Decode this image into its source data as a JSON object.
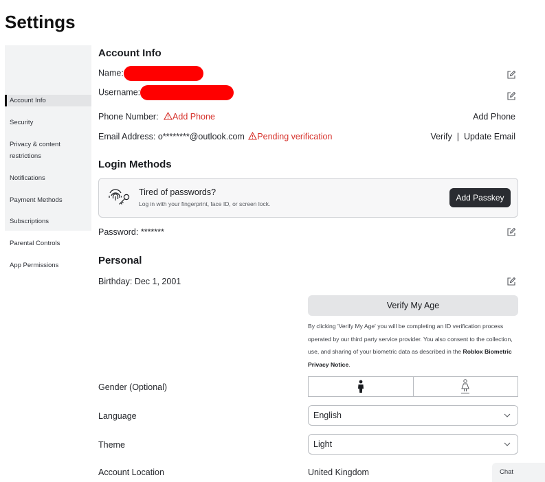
{
  "page": {
    "title": "Settings"
  },
  "sidebar": {
    "items": [
      {
        "label": "Account Info",
        "active": true
      },
      {
        "label": "Security"
      },
      {
        "label": "Privacy & content restrictions"
      },
      {
        "label": "Notifications"
      },
      {
        "label": "Payment Methods"
      },
      {
        "label": "Subscriptions"
      },
      {
        "label": "Parental Controls"
      },
      {
        "label": "App Permissions"
      }
    ]
  },
  "account_info": {
    "heading": "Account Info",
    "name_label": "Name:",
    "username_label": "Username:",
    "phone_label": "Phone Number:",
    "phone_warning": "Add Phone",
    "phone_action": "Add Phone",
    "email_label": "Email Address:",
    "email_value": "o********@outlook.com",
    "email_warning": "Pending verification",
    "verify_label": "Verify",
    "separator": "|",
    "update_email_label": "Update Email"
  },
  "login_methods": {
    "heading": "Login Methods",
    "passkey_title": "Tired of passwords?",
    "passkey_subtitle": "Log in with your fingerprint, face ID, or screen lock.",
    "passkey_button": "Add Passkey",
    "password_label": "Password:",
    "password_value": "*******"
  },
  "personal": {
    "heading": "Personal",
    "birthday_label": "Birthday:",
    "birthday_value": "Dec 1, 2001",
    "verify_age_button": "Verify My Age",
    "disclaimer_text": "By clicking 'Verify My Age' you will be completing an ID verification process operated by our third party service provider. You also consent to the collection, use, and sharing of your biometric data as described in the ",
    "disclaimer_link": "Roblox Biometric Privacy Notice",
    "disclaimer_end": ".",
    "gender_label": "Gender (Optional)",
    "language_label": "Language",
    "language_value": "English",
    "theme_label": "Theme",
    "theme_value": "Light",
    "location_label": "Account Location",
    "location_value": "United Kingdom"
  },
  "chat": {
    "label": "Chat"
  },
  "colors": {
    "warning": "#d6302a",
    "redaction": "#ff0000",
    "primary_button": "#2a2c31"
  }
}
